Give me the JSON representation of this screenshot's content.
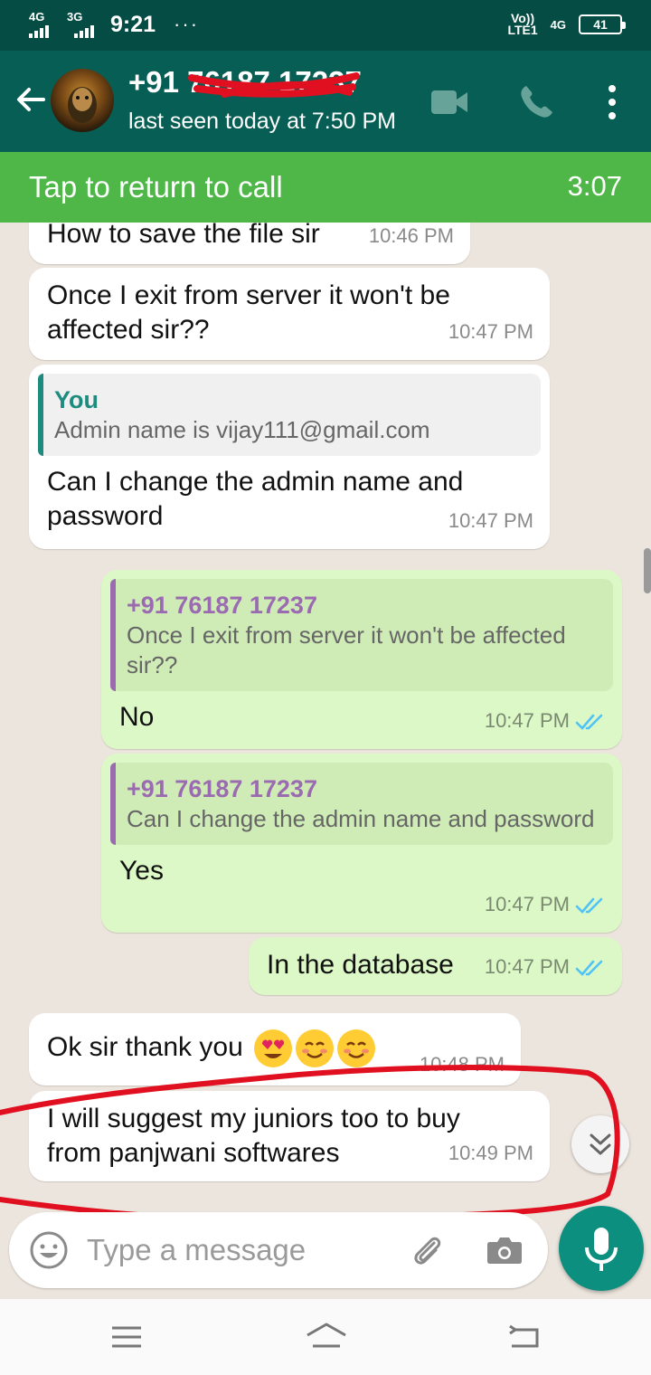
{
  "status_bar": {
    "network1": "4G",
    "network2": "3G",
    "time": "9:21",
    "more": "···",
    "volte_top": "Vo))",
    "volte_bottom": "LTE1",
    "network_right": "4G",
    "battery": "41"
  },
  "header": {
    "contact_name": "+91 76187 17237",
    "last_seen": "last seen today at 7:50 PM"
  },
  "call_banner": {
    "label": "Tap to return to call",
    "timer": "3:07"
  },
  "messages": [
    {
      "direction": "in",
      "text": "How to save the file sir",
      "time": "10:46 PM"
    },
    {
      "direction": "in",
      "text": "Once I exit from server it won't be affected sir??",
      "time": "10:47 PM"
    },
    {
      "direction": "in",
      "quote_author": "You",
      "quote_text": "Admin name is vijay111@gmail.com",
      "text": "Can I change the admin name and password",
      "time": "10:47 PM"
    },
    {
      "direction": "out",
      "quote_author": "+91 76187 17237",
      "quote_text": "Once I exit from server it won't be affected sir??",
      "text": "No",
      "time": "10:47 PM"
    },
    {
      "direction": "out",
      "quote_author": "+91 76187 17237",
      "quote_text": "Can I change the admin name and password",
      "text": "Yes",
      "time": "10:47 PM"
    },
    {
      "direction": "out",
      "text": "In the database",
      "time": "10:47 PM"
    },
    {
      "direction": "in",
      "text": "Ok sir thank you",
      "emojis": [
        "heart-eyes",
        "smiling-face",
        "smiling-face"
      ],
      "time": "10:48 PM"
    },
    {
      "direction": "in",
      "text": "I will suggest my juniors too to buy from panjwani softwares",
      "time": "10:49 PM"
    }
  ],
  "input": {
    "placeholder": "Type a message"
  },
  "colors": {
    "status_bar": "#054d44",
    "header": "#075e54",
    "call_banner": "#4fb747",
    "incoming_bubble": "#ffffff",
    "outgoing_bubble": "#dcf8c6",
    "read_ticks": "#4fc3f7",
    "mic_button": "#0d8f80",
    "annotation": "#e01020"
  },
  "icons": {
    "back": "arrow-left-icon",
    "video_call": "video-camera-icon",
    "voice_call": "phone-icon",
    "menu": "more-vertical-icon",
    "emoji": "smiley-icon",
    "attach": "paperclip-icon",
    "camera": "camera-icon",
    "mic": "microphone-icon",
    "scroll_down": "double-chevron-down-icon",
    "nav_menu": "hamburger-icon",
    "nav_home": "home-icon",
    "nav_back": "back-arrow-icon"
  }
}
